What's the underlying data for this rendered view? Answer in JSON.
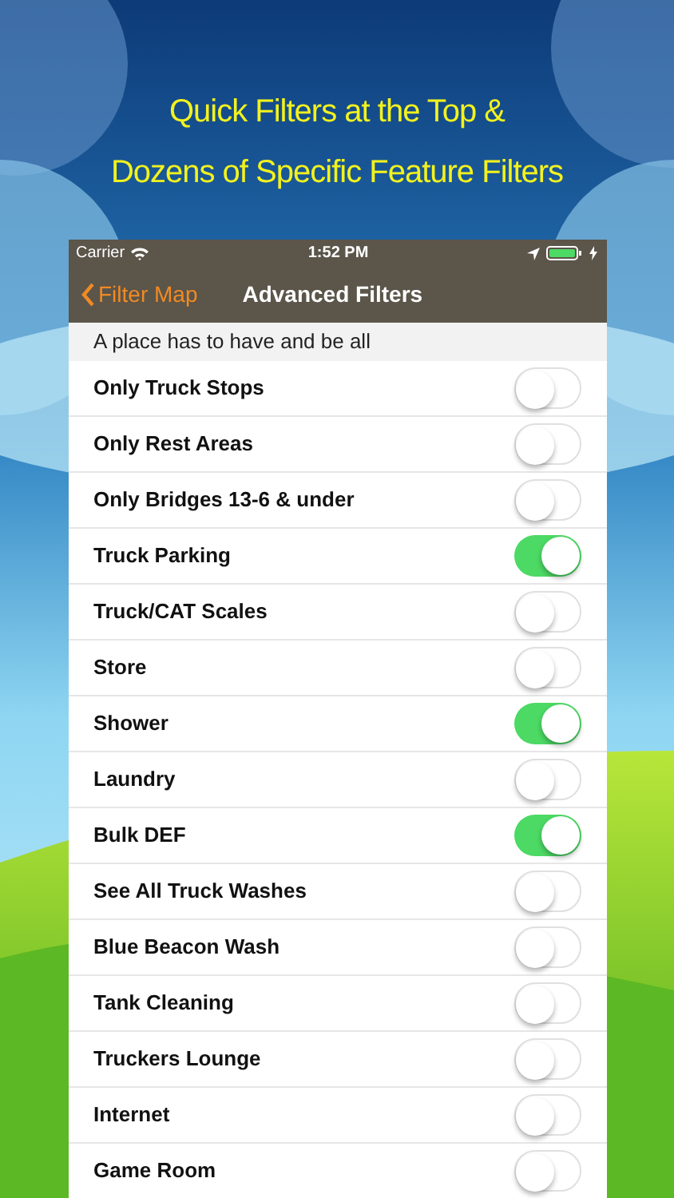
{
  "headline": [
    "Quick Filters at the Top &",
    "Dozens of Specific Feature Filters"
  ],
  "status_bar": {
    "carrier": "Carrier",
    "time": "1:52 PM"
  },
  "nav_bar": {
    "back": "Filter Map",
    "title": "Advanced Filters"
  },
  "section_header": "A place has to have and be all",
  "filters": [
    {
      "label": "Only Truck Stops",
      "on": false
    },
    {
      "label": "Only Rest Areas",
      "on": false
    },
    {
      "label": "Only Bridges 13-6 & under",
      "on": false
    },
    {
      "label": "Truck Parking",
      "on": true
    },
    {
      "label": "Truck/CAT Scales",
      "on": false
    },
    {
      "label": "Store",
      "on": false
    },
    {
      "label": "Shower",
      "on": true
    },
    {
      "label": "Laundry",
      "on": false
    },
    {
      "label": "Bulk DEF",
      "on": true
    },
    {
      "label": "See All Truck Washes",
      "on": false
    },
    {
      "label": "Blue Beacon Wash",
      "on": false
    },
    {
      "label": "Tank Cleaning",
      "on": false
    },
    {
      "label": "Truckers Lounge",
      "on": false
    },
    {
      "label": "Internet",
      "on": false
    },
    {
      "label": "Game Room",
      "on": false
    }
  ]
}
